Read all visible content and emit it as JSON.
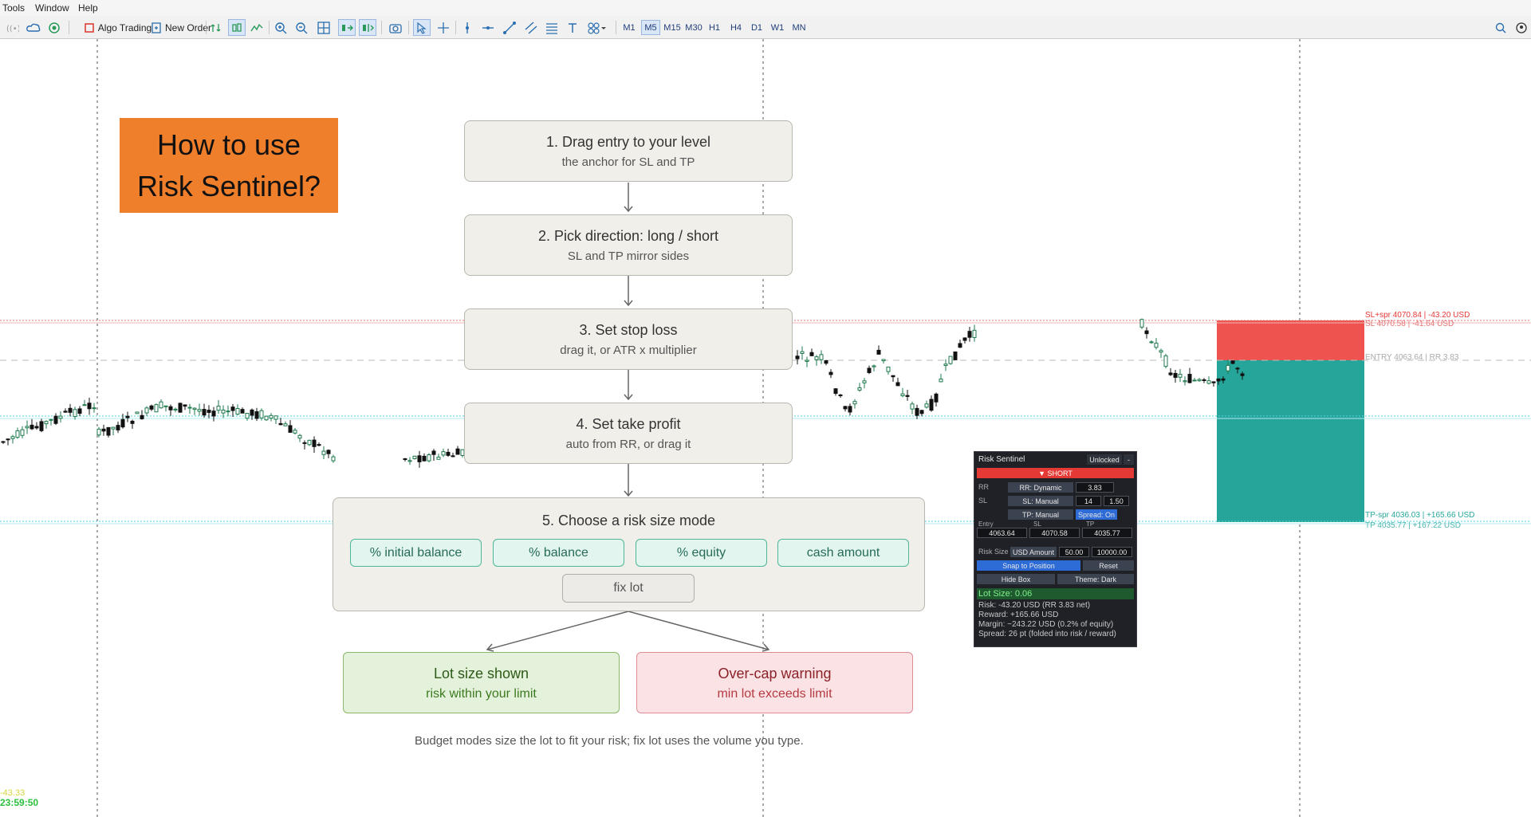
{
  "menu": {
    "items": [
      "Tools",
      "Window",
      "Help"
    ]
  },
  "toolbar": {
    "algo_trading_label": "Algo Trading",
    "new_order_label": "New Order",
    "timeframes": [
      "M1",
      "M5",
      "M15",
      "M30",
      "H1",
      "H4",
      "D1",
      "W1",
      "MN"
    ],
    "active_timeframe": "M5",
    "icons": [
      "depth-of-market-icon",
      "cloud-icon",
      "signals-icon",
      "stop-icon",
      "new-order-icon",
      "trade-history-icon",
      "candlestick-icon",
      "line-chart-icon",
      "zoom-in-icon",
      "zoom-out-icon",
      "grid-icon",
      "autoscroll-icon",
      "shift-chart-icon",
      "screenshot-icon",
      "cursor-icon",
      "crosshair-icon",
      "vertical-line-icon",
      "horizontal-line-icon",
      "trendline-icon",
      "channel-icon",
      "fibonacci-icon",
      "text-icon",
      "shapes-icon",
      "search-icon",
      "account-icon"
    ]
  },
  "tutorial": {
    "title_line1": "How to use",
    "title_line2": "Risk Sentinel?",
    "steps": [
      {
        "title": "1. Drag entry to your level",
        "subtitle": "the anchor for SL and TP"
      },
      {
        "title": "2. Pick direction: long / short",
        "subtitle": "SL and TP mirror sides"
      },
      {
        "title": "3. Set stop loss",
        "subtitle": "drag it, or ATR x multiplier"
      },
      {
        "title": "4. Set take profit",
        "subtitle": "auto from RR, or drag it"
      }
    ],
    "mode_title": "5. Choose a risk size mode",
    "modes": [
      "% initial balance",
      "% balance",
      "% equity",
      "cash amount"
    ],
    "fix_lot": "fix lot",
    "outcome_ok_title": "Lot size shown",
    "outcome_ok_sub": "risk within your limit",
    "outcome_warn_title": "Over-cap warning",
    "outcome_warn_sub": "min lot exceeds limit",
    "footnote": "Budget modes size the lot to fit your risk; fix lot uses the volume you type."
  },
  "chart": {
    "sl_spread_label": "SL+spr 4070.84 | -43.20 USD",
    "sl_label": "SL 4070.58 | -41.64 USD",
    "entry_label": "ENTRY 4063.64 | RR 3.83",
    "tp_spread_label": "TP-spr 4036.03 | +165.66 USD",
    "tp_label": "TP 4035.77 | +167.22 USD",
    "clock_top": "-43.33",
    "clock": "23:59:50",
    "colors": {
      "bull": "#1f7a4d",
      "bear": "#111111",
      "risk_zone": "#ef5350",
      "reward_zone": "#26a69a",
      "sl_line": "#e57373",
      "tp_line": "#4dd0e1"
    }
  },
  "panel": {
    "title": "Risk Sentinel",
    "lock_label": "Unlocked",
    "minimize_label": "-",
    "direction_label": "▼ SHORT",
    "rr_label": "RR",
    "rr_mode": "RR: Dynamic",
    "rr_value": "3.83",
    "sl_label": "SL",
    "sl_mode": "SL: Manual",
    "sl_value1": "14",
    "sl_value2": "1.50",
    "tp_mode": "TP: Manual",
    "spread_toggle": "Spread: On",
    "entry_header": "Entry",
    "sl_header": "SL",
    "tp_header": "TP",
    "entry_value": "4063.64",
    "sl_price": "4070.58",
    "tp_price": "4035.77",
    "risk_size_label": "Risk Size",
    "risk_mode": "USD Amount",
    "risk_amount": "50.00",
    "risk_balance": "10000.00",
    "snap_button": "Snap to Position",
    "reset_button": "Reset",
    "hide_box_button": "Hide Box",
    "theme_button": "Theme: Dark",
    "lot_size": "Lot Size:  0.06",
    "risk_line": "Risk:  -43.20 USD   (RR 3.83 net)",
    "reward_line": "Reward:  +165.66 USD",
    "margin_line": "Margin:  ~243.22 USD   (0.2% of equity)",
    "spread_line": "Spread:  26 pt  (folded into risk / reward)"
  }
}
